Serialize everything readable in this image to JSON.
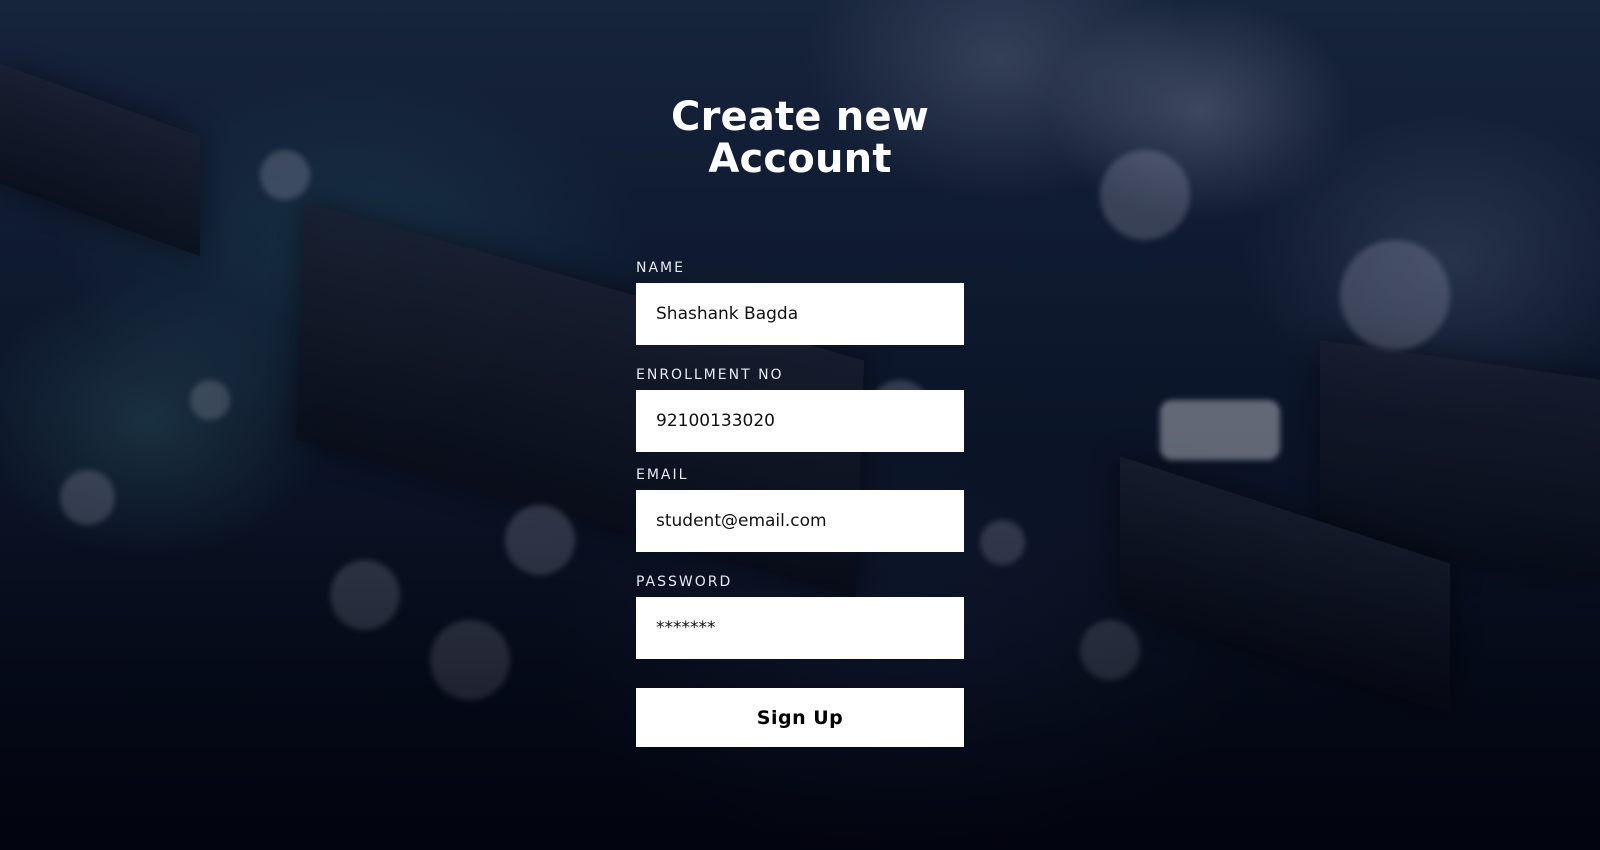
{
  "page": {
    "title": "Create new Account"
  },
  "form": {
    "fields": [
      {
        "label": "NAME",
        "value": "Shashank Bagda",
        "type": "text"
      },
      {
        "label": "ENROLLMENT NO",
        "value": "92100133020",
        "type": "text"
      },
      {
        "label": "EMAIL",
        "value": "student@email.com",
        "type": "email"
      },
      {
        "label": "PASSWORD",
        "value": "*******",
        "type": "text"
      }
    ],
    "submit_label": "Sign Up"
  },
  "colors": {
    "background_dark": "#0a1424",
    "text_light": "#ffffff",
    "input_bg": "#ffffff",
    "button_text": "#000000"
  }
}
